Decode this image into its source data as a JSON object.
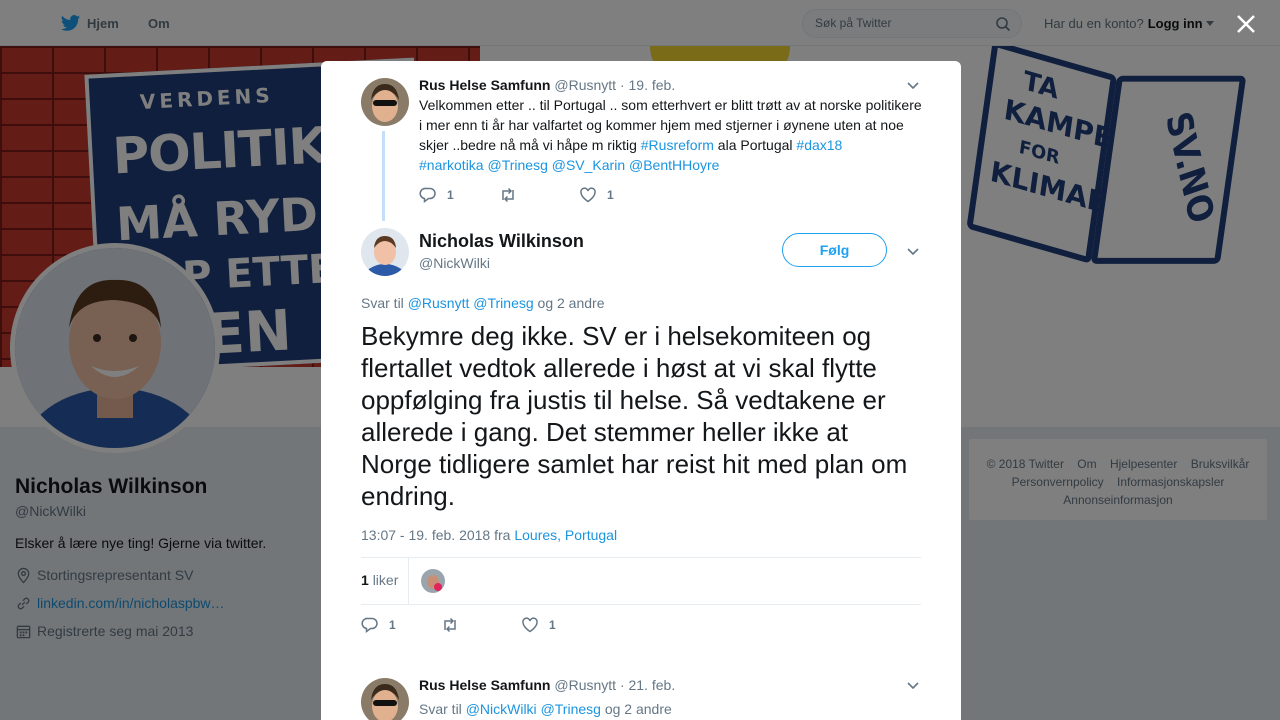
{
  "topbar": {
    "home_label": "Hjem",
    "about_label": "Om",
    "search_placeholder": "Søk på Twitter",
    "account_prompt": "Har du en konto?",
    "login_label": "Logg inn"
  },
  "banner": {
    "sign_lines": [
      "VERDENS",
      "POLITIKERE",
      "MÅ RYDDE",
      "OPP ETTER",
      "EGEN"
    ],
    "book_lines": [
      "TA",
      "KAMPEN",
      "FOR",
      "KLIMAET",
      "SV.NO"
    ]
  },
  "profile": {
    "name": "Nicholas Wilkinson",
    "handle": "@NickWilki",
    "bio": "Elsker å lære nye ting! Gjerne via twitter.",
    "location": "Stortingsrepresentant SV",
    "link": "linkedin.com/in/nicholaspbw…",
    "joined": "Registrerte seg mai 2013"
  },
  "footer": {
    "items": [
      "© 2018 Twitter",
      "Om",
      "Hjelpesenter",
      "Bruksvilkår",
      "Personvernpolicy",
      "Informasjonskapsler",
      "Annonseinformasjon"
    ]
  },
  "parent_tweet": {
    "name": "Rus Helse Samfunn",
    "handle": "@Rusnytt",
    "date": "19. feb.",
    "text_plain": "Velkommen etter .. til  Portugal .. som etterhvert er blitt trøtt av at norske politikere i mer enn ti år har valfartet og kommer hjem med stjerner i øynene uten at noe skjer ..bedre nå må vi håpe m riktig ",
    "hashtag_1": "#Rusreform",
    "text_mid": " ala Portugal  ",
    "hashtag_2": "#dax18",
    "tags_line": "#narkotika @Trinesg @SV_Karin @BentHHoyre",
    "reply_count": "1",
    "like_count": "1"
  },
  "main_tweet": {
    "name": "Nicholas Wilkinson",
    "handle": "@NickWilki",
    "follow_label": "Følg",
    "reply_prefix": "Svar til",
    "reply_mention_1": "@Rusnytt",
    "reply_mention_2": "@Trinesg",
    "reply_suffix": "og 2 andre",
    "text": "Bekymre deg ikke. SV er i helsekomiteen og flertallet vedtok allerede i høst at vi skal flytte oppfølging fra justis til helse. Så vedtakene er allerede i gang. Det stemmer heller ikke at Norge tidligere samlet har reist hit med plan om endring.",
    "timestamp": "13:07 - 19. feb. 2018 fra",
    "location": "Loures, Portugal",
    "likes_number": "1",
    "likes_label": "liker",
    "reply_count": "1",
    "like_count": "1"
  },
  "next_tweet": {
    "name": "Rus Helse Samfunn",
    "handle": "@Rusnytt",
    "date": "21. feb.",
    "reply_prefix": "Svar til",
    "reply_mention_1": "@NickWilki",
    "reply_mention_2": "@Trinesg",
    "reply_suffix": "og 2 andre"
  },
  "colors": {
    "twitter_blue": "#1da1f2",
    "link_blue": "#1b95e0",
    "thread_line": "#c4dffa"
  }
}
